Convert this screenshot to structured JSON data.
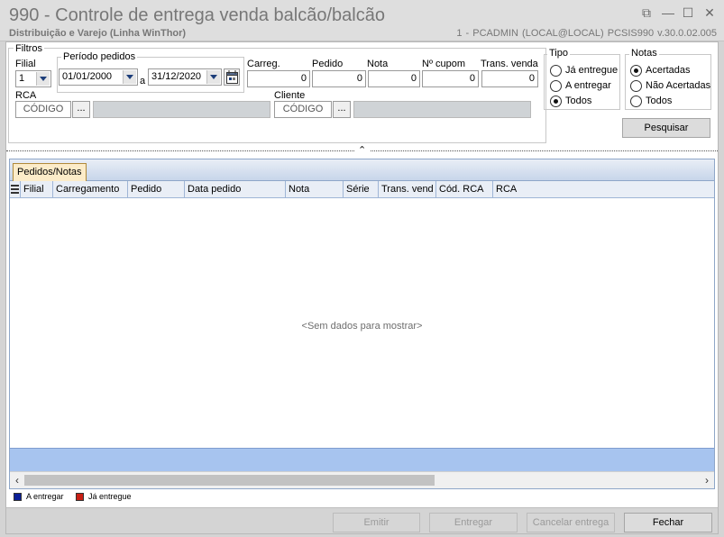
{
  "window": {
    "title": "990 - Controle de entrega venda balcão/balcão",
    "subtitle": "Distribuição e Varejo (Linha WinThor)",
    "info": "1 - PCADMIN (LOCAL@LOCAL)  PCSIS990  v.30.0.02.005",
    "controls": {
      "restore": "⧉",
      "minimize": "—",
      "maximize": "☐",
      "close": "✕"
    }
  },
  "filters": {
    "legend": "Filtros",
    "filial": {
      "label": "Filial",
      "value": "1"
    },
    "periodo": {
      "legend": "Período pedidos",
      "start": "01/01/2000",
      "separator": "a",
      "end": "31/12/2020"
    },
    "carreg": {
      "label": "Carreg.",
      "value": "0"
    },
    "pedido": {
      "label": "Pedido",
      "value": "0"
    },
    "nota": {
      "label": "Nota",
      "value": "0"
    },
    "cupom": {
      "label": "Nº cupom",
      "value": "0"
    },
    "trans_venda": {
      "label": "Trans. venda",
      "value": "0"
    },
    "rca": {
      "label": "RCA",
      "code_placeholder": "CÓDIGO",
      "browse": "...",
      "name": ""
    },
    "cliente": {
      "label": "Cliente",
      "code_placeholder": "CÓDIGO",
      "browse": "...",
      "name": ""
    },
    "tipo": {
      "legend": "Tipo",
      "options": [
        "Já entregue",
        "A entregar",
        "Todos"
      ],
      "selected": "Todos"
    },
    "notas": {
      "legend": "Notas",
      "options": [
        "Acertadas",
        "Não Acertadas",
        "Todos"
      ],
      "selected": "Acertadas"
    },
    "search_button": "Pesquisar"
  },
  "grid": {
    "tab": "Pedidos/Notas",
    "columns": [
      "Filial",
      "Carregamento",
      "Pedido",
      "Data pedido",
      "Nota",
      "Série",
      "Trans. vend",
      "Cód. RCA",
      "RCA"
    ],
    "empty_message": "<Sem dados para mostrar>"
  },
  "legend": {
    "items": [
      {
        "label": "A entregar",
        "color": "#0a1e96"
      },
      {
        "label": "Já entregue",
        "color": "#c81e14"
      }
    ]
  },
  "footer": {
    "emitir": "Emitir",
    "entregar": "Entregar",
    "cancelar": "Cancelar entrega",
    "fechar": "Fechar"
  },
  "colors": {
    "grid_footer": "#a7c4ef",
    "tab_active": "#fcecc9"
  }
}
